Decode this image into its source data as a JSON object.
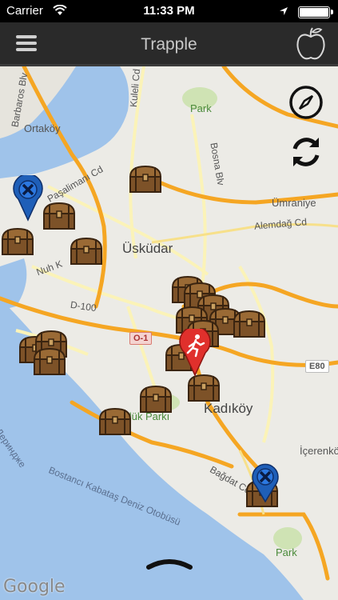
{
  "status_bar": {
    "carrier": "Carrier",
    "time": "11:33 PM"
  },
  "nav": {
    "title": "Trapple",
    "menu_icon": "hamburger-menu-icon",
    "logo_icon": "apple-outline-icon"
  },
  "map": {
    "labels": {
      "ortakoy": "Ortaköy",
      "uskudar": "Üsküdar",
      "umraniye": "Ümraniye",
      "kadikoy": "Kadıköy",
      "icerenkoy": "İçerenkö",
      "park1": "Park",
      "park2": "Park",
      "park3": "Ürlük Parkı",
      "barbaros": "Barbaros Blv",
      "kuleli": "Kuleli Cd",
      "bosna": "Bosna Blv",
      "alemdag": "Alemdağ Cd",
      "nuh": "Nuh K",
      "paşalimanı": "Paşalimanı Cd",
      "d100": "D-100",
      "bagdat": "Bağdat Cd",
      "derinjke": "Дериндже",
      "ferry": "Bostancı Kabataş Deniz Otobüsü"
    },
    "shields": {
      "o1": "O-1",
      "e80": "E80"
    },
    "attribution": "Google",
    "controls": {
      "compass_icon": "compass-icon",
      "refresh_icon": "refresh-icon",
      "handle_icon": "pull-up-handle-icon"
    }
  },
  "colors": {
    "water": "#9fc3ea",
    "land": "#ecebe6",
    "road_major": "#f5a623",
    "road_minor": "#f7e08a",
    "nav_bg": "#2a2a2a",
    "chest": "#8a5a2b",
    "pin_red": "#e0302c",
    "pin_blue": "#1f5fb8"
  }
}
